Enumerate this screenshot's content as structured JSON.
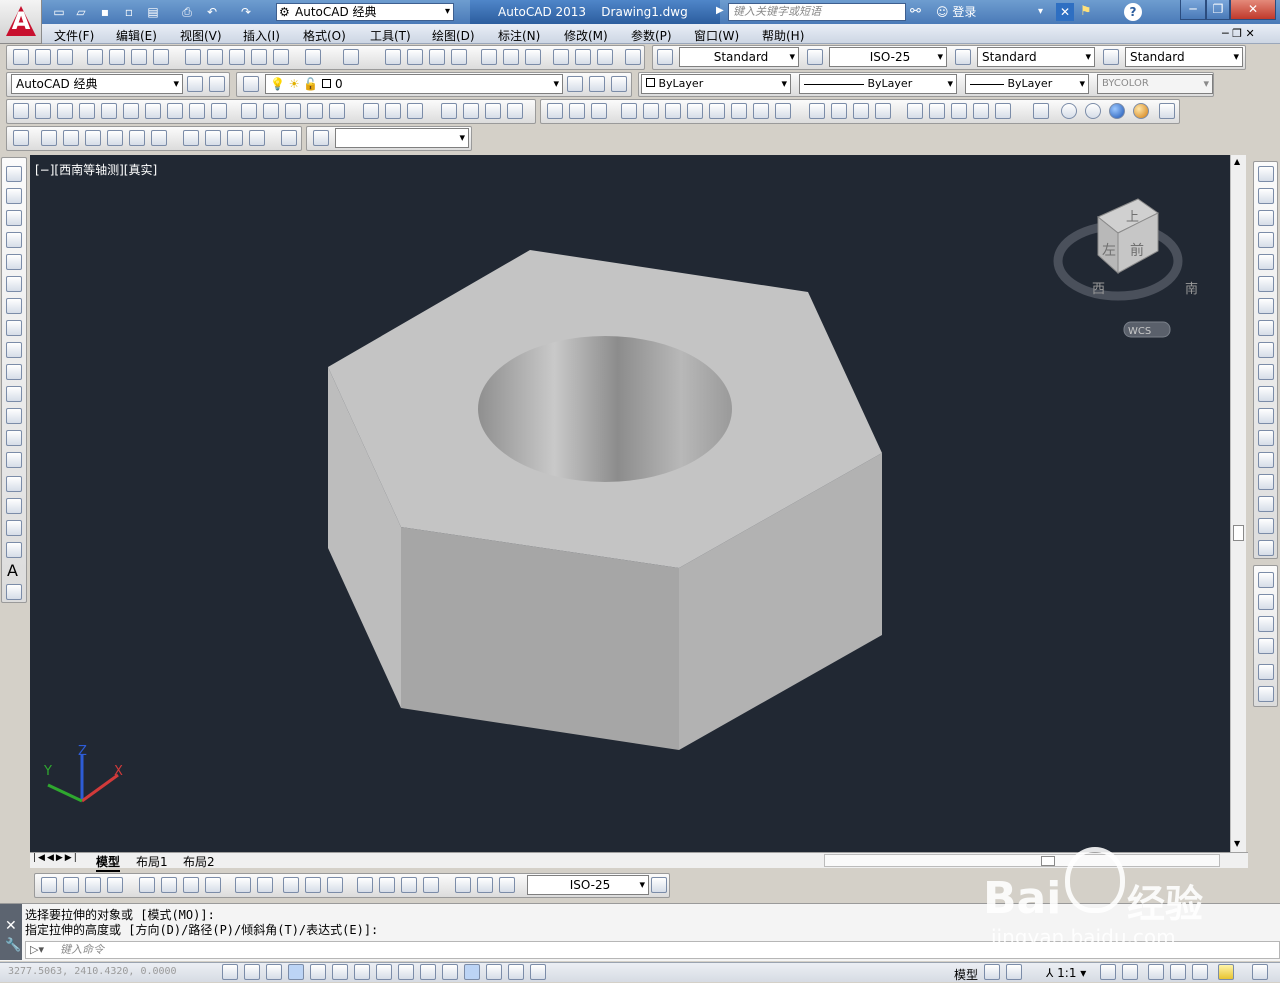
{
  "titlebar": {
    "workspace": "AutoCAD 经典",
    "app_title": "AutoCAD 2013    Drawing1.dwg",
    "search_placeholder": "键入关键字或短语",
    "login": "登录"
  },
  "menubar": {
    "items": [
      "文件(F)",
      "编辑(E)",
      "视图(V)",
      "插入(I)",
      "格式(O)",
      "工具(T)",
      "绘图(D)",
      "标注(N)",
      "修改(M)",
      "参数(P)",
      "窗口(W)",
      "帮助(H)"
    ]
  },
  "styles_toolbar": {
    "text_style": "Standard",
    "dim_style": "ISO-25",
    "table_style": "Standard",
    "multileader_style": "Standard"
  },
  "workspace_toolbar": {
    "workspace": "AutoCAD 经典",
    "layer": "0"
  },
  "properties_toolbar": {
    "color": "ByLayer",
    "linetype": "ByLayer",
    "lineweight": "ByLayer",
    "plotstyle": "BYCOLOR"
  },
  "viewport": {
    "label": "[−][西南等轴测][真实]",
    "viewcube": {
      "top": "上",
      "left": "左",
      "front": "前",
      "compass_w": "西",
      "compass_s": "南",
      "wcs": "WCS"
    },
    "ucs": {
      "x": "X",
      "y": "Y",
      "z": "Z"
    }
  },
  "layout_tabs": [
    "模型",
    "布局1",
    "布局2"
  ],
  "dim_toolbar": {
    "dim_style": "ISO-25"
  },
  "command": {
    "history_1": "选择要拉伸的对象或 [模式(MO)]:",
    "history_2": "指定拉伸的高度或 [方向(D)/路径(P)/倾斜角(T)/表达式(E)]:",
    "input_placeholder": "键入命令"
  },
  "status": {
    "coordinates": "3277.5063,  2410.4320,  0.0000",
    "model_label": "模型",
    "scale": "1:1"
  },
  "watermark": {
    "brand": "Bai",
    "brand2": "经验",
    "url": "jingyan.baidu.com"
  },
  "colors": {
    "viewport_bg": "#212833",
    "accent": "#2c5d9e"
  }
}
